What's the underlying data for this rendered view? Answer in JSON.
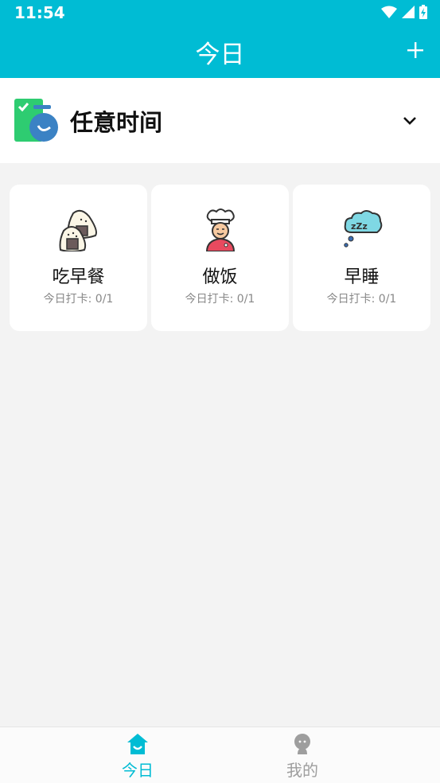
{
  "status_bar": {
    "time": "11:54"
  },
  "header": {
    "title": "今日"
  },
  "filter": {
    "label": "任意时间"
  },
  "habits": [
    {
      "title": "吃早餐",
      "progress": "今日打卡: 0/1",
      "icon": "rice-ball-icon"
    },
    {
      "title": "做饭",
      "progress": "今日打卡: 0/1",
      "icon": "chef-icon"
    },
    {
      "title": "早睡",
      "progress": "今日打卡: 0/1",
      "icon": "sleep-icon"
    }
  ],
  "nav": {
    "today_label": "今日",
    "mine_label": "我的"
  },
  "colors": {
    "primary": "#00bcd4",
    "inactive": "#9e9e9e",
    "card_bg": "#ffffff",
    "page_bg": "#f3f3f3"
  }
}
